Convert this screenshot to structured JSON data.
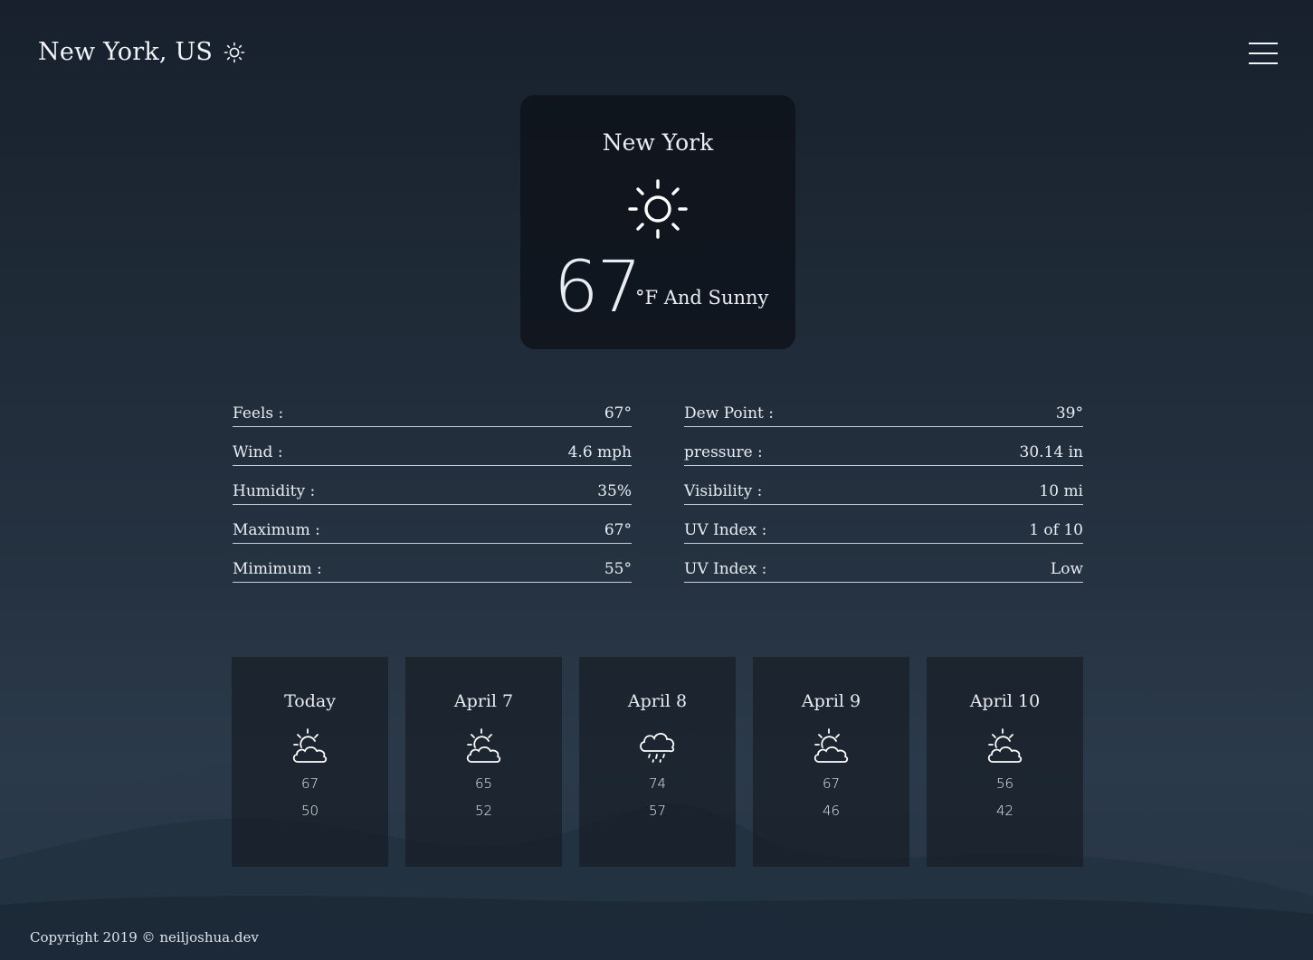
{
  "header": {
    "location": "New York, US",
    "weather_icon": "sun-icon",
    "menu_icon": "hamburger-menu-icon"
  },
  "current": {
    "city": "New York",
    "icon": "sun-icon",
    "temperature": "67",
    "condition": "°F And Sunny"
  },
  "details_left": [
    {
      "label": "Feels :",
      "value": "67°"
    },
    {
      "label": "Wind :",
      "value": "4.6 mph"
    },
    {
      "label": "Humidity :",
      "value": "35%"
    },
    {
      "label": "Maximum :",
      "value": "67°"
    },
    {
      "label": "Mimimum :",
      "value": "55°"
    }
  ],
  "details_right": [
    {
      "label": "Dew Point :",
      "value": "39°"
    },
    {
      "label": "pressure :",
      "value": "30.14 in"
    },
    {
      "label": "Visibility :",
      "value": "10 mi"
    },
    {
      "label": "UV Index :",
      "value": "1 of 10"
    },
    {
      "label": "UV Index :",
      "value": "Low"
    }
  ],
  "forecast": [
    {
      "day": "Today",
      "icon": "partly-cloudy-icon",
      "high": "67",
      "low": "50"
    },
    {
      "day": "April 7",
      "icon": "partly-cloudy-icon",
      "high": "65",
      "low": "52"
    },
    {
      "day": "April 8",
      "icon": "rain-icon",
      "high": "74",
      "low": "57"
    },
    {
      "day": "April 9",
      "icon": "partly-cloudy-icon",
      "high": "67",
      "low": "46"
    },
    {
      "day": "April 10",
      "icon": "partly-cloudy-icon",
      "high": "56",
      "low": "42"
    }
  ],
  "footer": {
    "copyright": "Copyright 2019 © neiljoshua.dev"
  },
  "colors": {
    "background_top": "#17202c",
    "background_bottom": "#2b3a4a",
    "card": "#0d1118",
    "text": "#e9edf2"
  }
}
